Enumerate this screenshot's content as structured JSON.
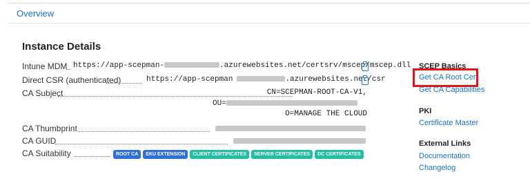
{
  "tab": {
    "label": "Overview"
  },
  "instance": {
    "title": "Instance Details",
    "intune": {
      "label": "Intune MDM",
      "url_prefix": "https://app-scepman-",
      "url_suffix": ".azurewebsites.net/certsrv/mscep/mscep.dll"
    },
    "csr": {
      "label": "Direct CSR (authenticated)",
      "url_prefix": "https://app-scepman",
      "url_suffix": ".azurewebsites.net/csr"
    },
    "subject": {
      "label": "CA Subject",
      "line1": "CN=SCEPMAN-ROOT-CA-V1,",
      "line2_prefix": "OU=",
      "line3": "O=MANAGE THE CLOUD"
    },
    "thumbprint": {
      "label": "CA Thumbprint"
    },
    "guid": {
      "label": "CA GUID"
    },
    "suitability": {
      "label": "CA Suitability",
      "badges": [
        "ROOT CA",
        "EKU EXTENSION",
        "CLIENT CERTIFICATES",
        "SERVER CERTIFICATES",
        "DC CERTIFICATES"
      ]
    }
  },
  "sidebar": {
    "scep_heading": "SCEP Basics",
    "get_root_cert": "Get CA Root Cert",
    "get_capabilities": "Get CA Capabilities",
    "pki_heading": "PKI",
    "certificate_master": "Certificate Master",
    "external_heading": "External Links",
    "documentation": "Documentation",
    "changelog": "Changelog"
  },
  "colors": {
    "link": "#1a73c7",
    "badge_blue": "#2f6fd6",
    "badge_teal": "#1fbfa0",
    "highlight": "#e0141b"
  }
}
